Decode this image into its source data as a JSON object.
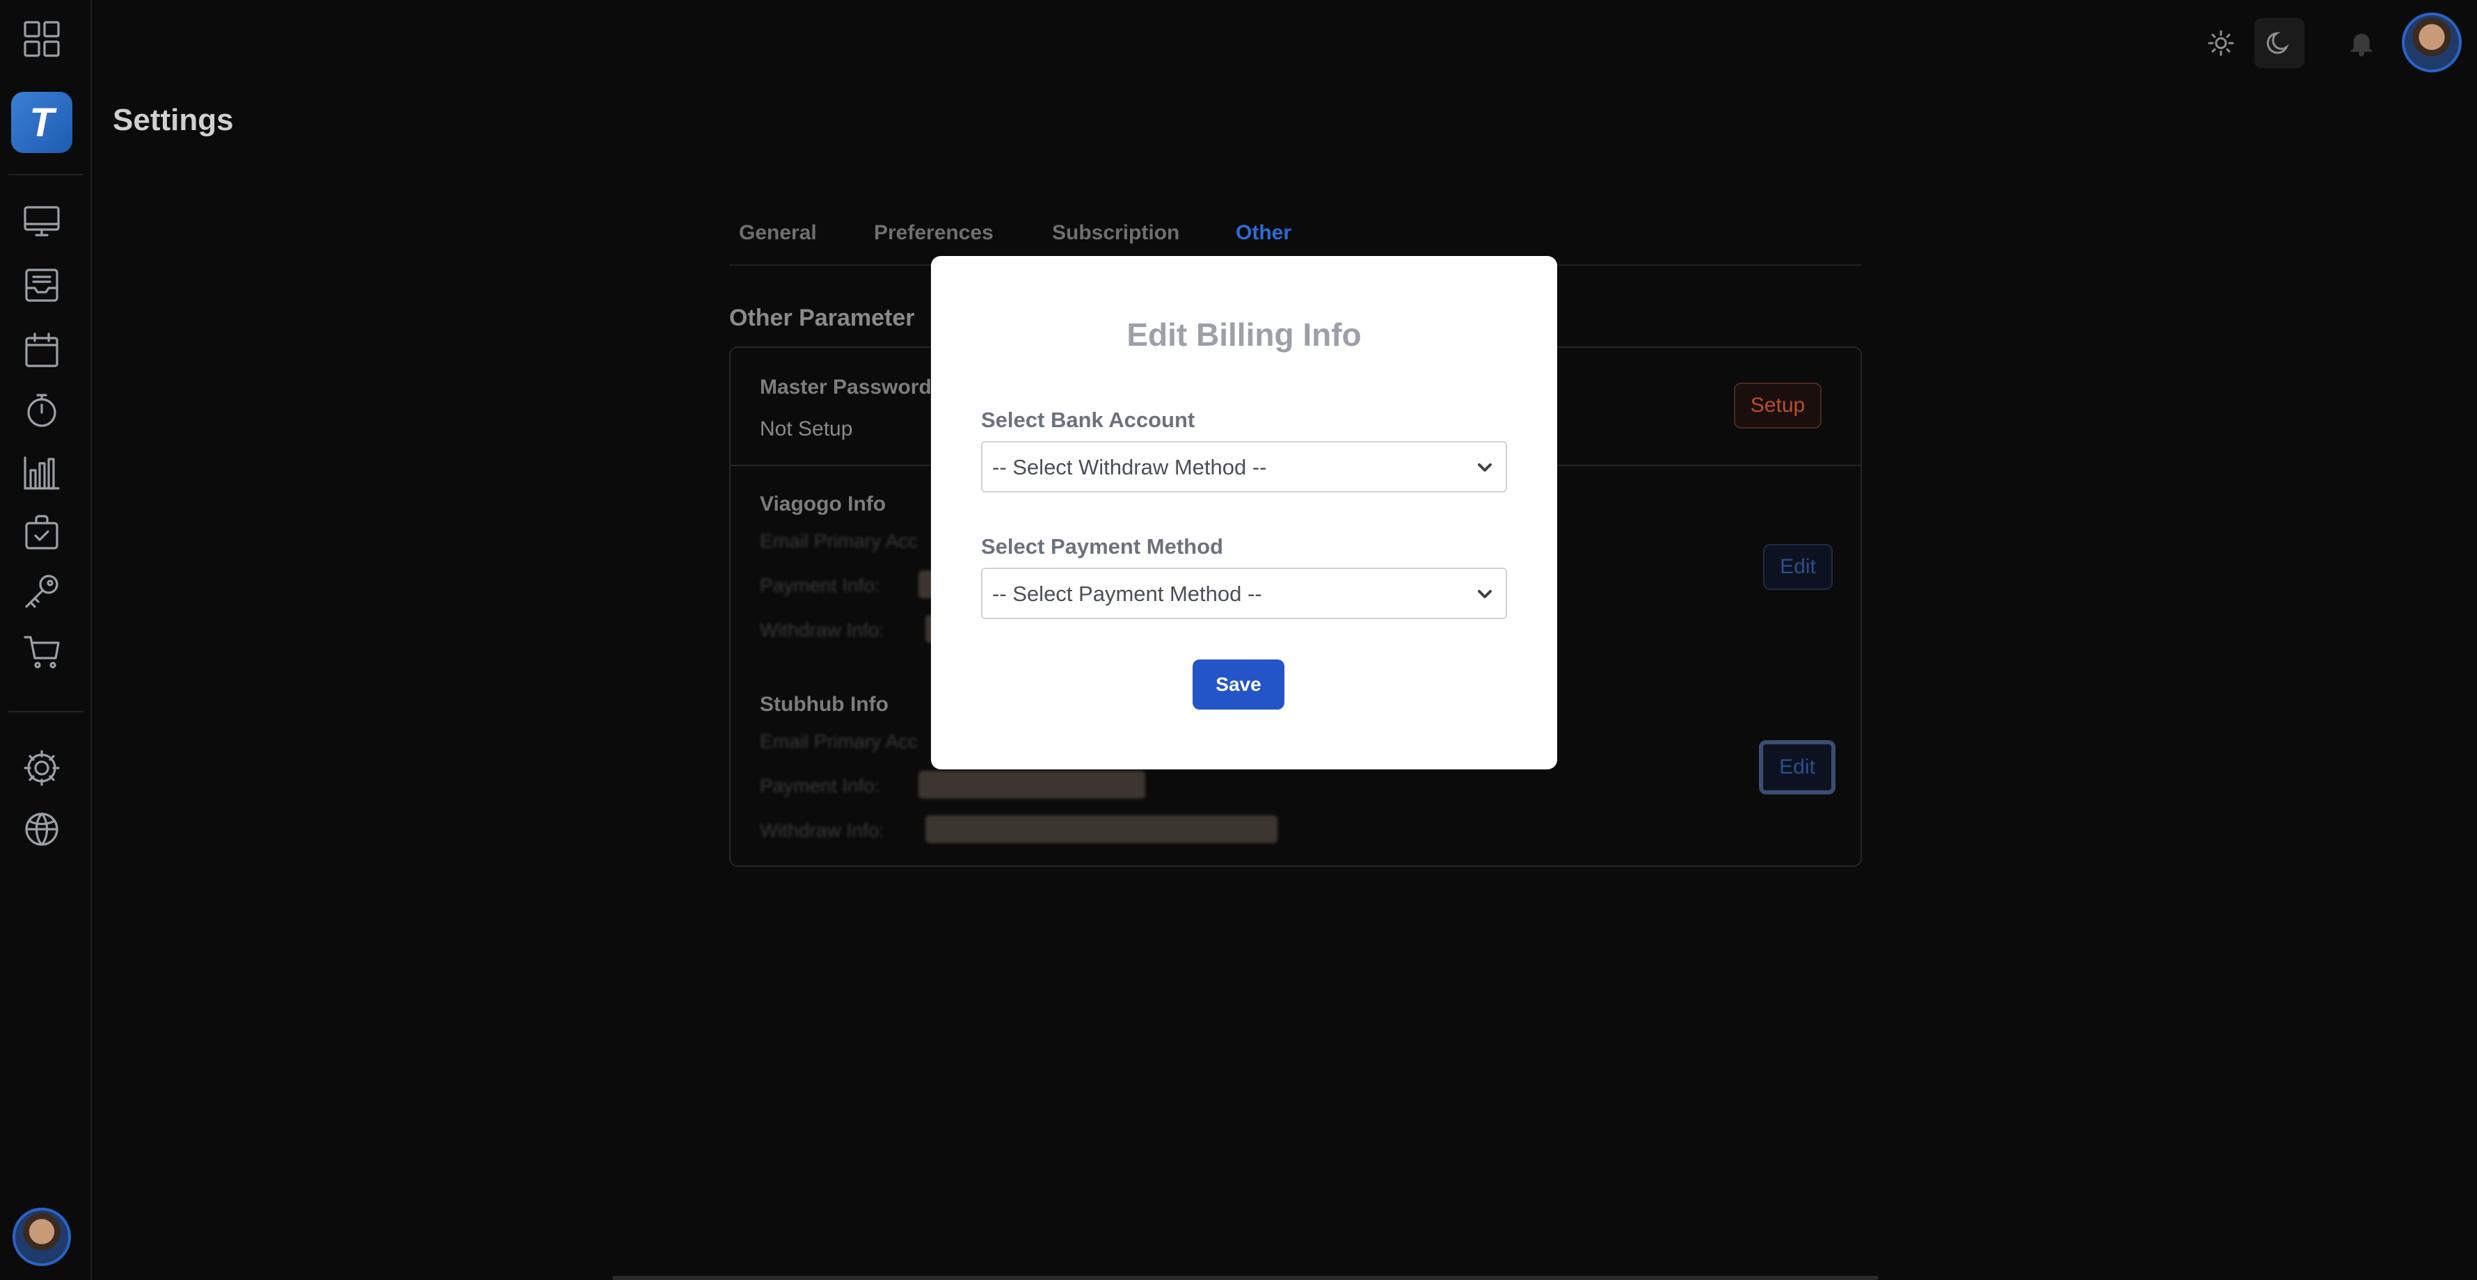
{
  "header": {
    "page_title": "Settings",
    "icons": [
      "apps-grid-icon",
      "sun-icon",
      "moon-icon",
      "bell-icon"
    ]
  },
  "sidebar": {
    "logo_letter": "T",
    "items": [
      {
        "icon": "monitor-icon"
      },
      {
        "icon": "inbox-icon"
      },
      {
        "icon": "calendar-icon"
      },
      {
        "icon": "timer-icon"
      },
      {
        "icon": "bar-chart-icon"
      },
      {
        "icon": "checklist-bag-icon"
      },
      {
        "icon": "key-icon"
      },
      {
        "icon": "cart-icon"
      },
      {
        "icon": "settings-gear-icon"
      },
      {
        "icon": "globe-icon"
      }
    ]
  },
  "tabs": [
    {
      "label": "General",
      "active": false
    },
    {
      "label": "Preferences",
      "active": false
    },
    {
      "label": "Subscription",
      "active": false
    },
    {
      "label": "Other",
      "active": true
    }
  ],
  "section": {
    "title": "Other Parameter",
    "master_password": {
      "label": "Master Password",
      "status": "Not Setup",
      "button": "Setup"
    },
    "viagogo": {
      "label": "Viagogo Info",
      "email_label": "Email Primary Acc",
      "payment_label": "Payment Info:",
      "withdraw_label": "Withdraw Info:",
      "button": "Edit"
    },
    "stubhub": {
      "label": "Stubhub Info",
      "email_label": "Email Primary Acc",
      "payment_label": "Payment Info:",
      "withdraw_label": "Withdraw Info:",
      "button": "Edit"
    }
  },
  "modal": {
    "title": "Edit Billing Info",
    "bank_label": "Select Bank Account",
    "bank_value": "-- Select Withdraw Method --",
    "payment_label": "Select Payment Method",
    "payment_value": "-- Select Payment Method --",
    "save": "Save"
  },
  "colors": {
    "accent": "#2455c8",
    "tab_active": "#2f6bd4",
    "setup_button": "#b84e30",
    "background": "#0b0b0b"
  }
}
